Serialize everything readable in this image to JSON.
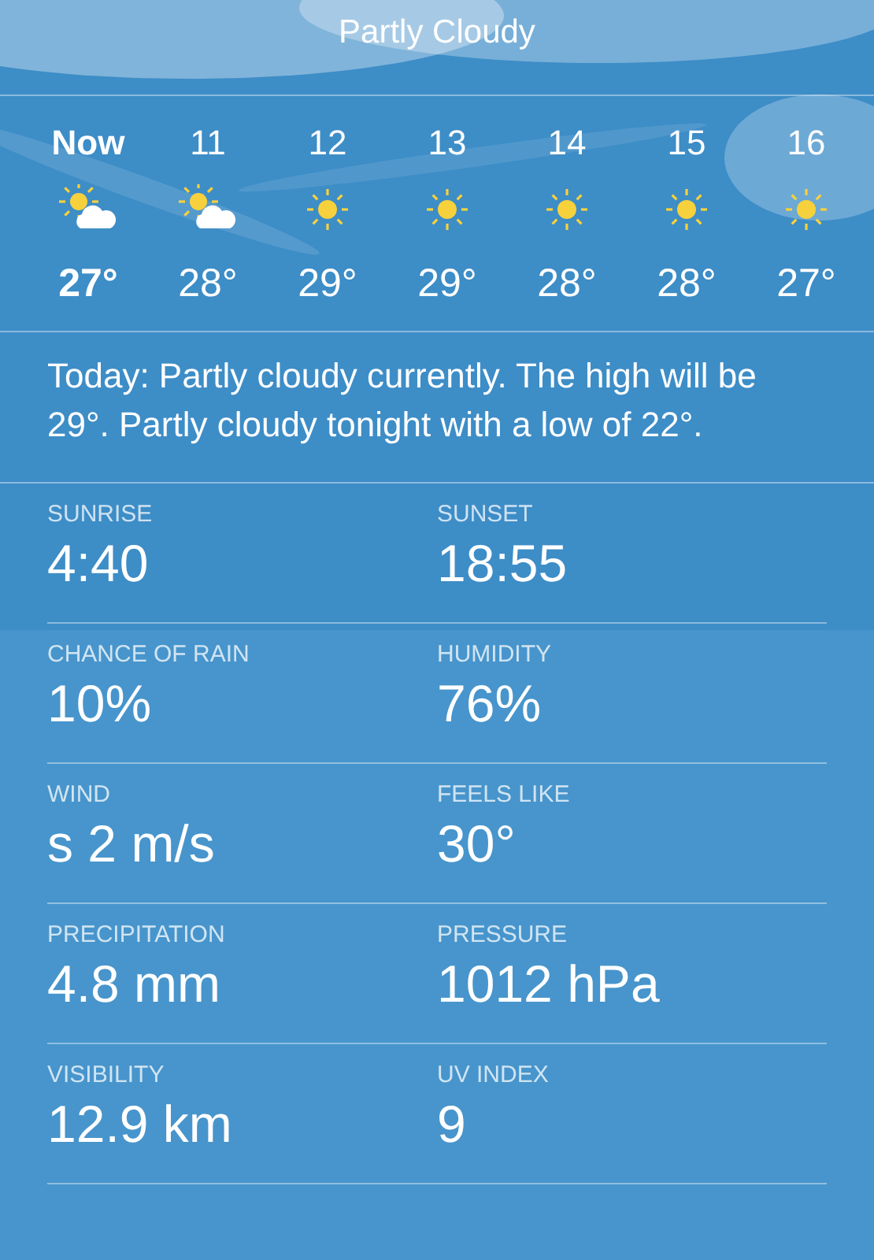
{
  "header": {
    "title": "Partly Cloudy"
  },
  "hourly": [
    {
      "hour": "Now",
      "current": true,
      "kind": "partly_cloudy",
      "temp": "27°"
    },
    {
      "hour": "11",
      "current": false,
      "kind": "partly_cloudy",
      "temp": "28°"
    },
    {
      "hour": "12",
      "current": false,
      "kind": "sunny",
      "temp": "29°"
    },
    {
      "hour": "13",
      "current": false,
      "kind": "sunny",
      "temp": "29°"
    },
    {
      "hour": "14",
      "current": false,
      "kind": "sunny",
      "temp": "28°"
    },
    {
      "hour": "15",
      "current": false,
      "kind": "sunny",
      "temp": "28°"
    },
    {
      "hour": "16",
      "current": false,
      "kind": "sunny",
      "temp": "27°"
    }
  ],
  "summary": "Today: Partly cloudy currently. The high will be 29°. Partly cloudy tonight with a low of 22°.",
  "details": [
    [
      {
        "label": "SUNRISE",
        "value": "4:40"
      },
      {
        "label": "SUNSET",
        "value": "18:55"
      }
    ],
    [
      {
        "label": "CHANCE OF RAIN",
        "value": "10%"
      },
      {
        "label": "HUMIDITY",
        "value": "76%"
      }
    ],
    [
      {
        "label": "WIND",
        "value": "s 2 m/s"
      },
      {
        "label": "FEELS LIKE",
        "value": "30°"
      }
    ],
    [
      {
        "label": "PRECIPITATION",
        "value": "4.8 mm"
      },
      {
        "label": "PRESSURE",
        "value": "1012 hPa"
      }
    ],
    [
      {
        "label": "VISIBILITY",
        "value": "12.9 km"
      },
      {
        "label": "UV INDEX",
        "value": "9"
      }
    ]
  ]
}
